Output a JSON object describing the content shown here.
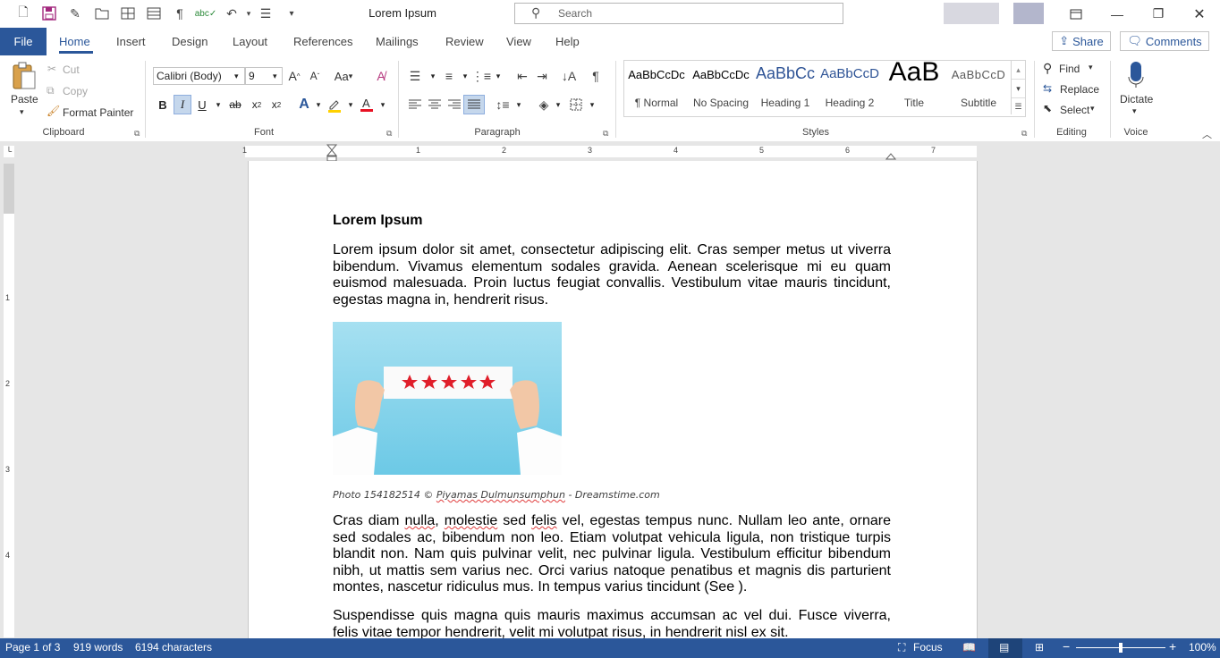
{
  "titlebar": {
    "doc_title": "Lorem Ipsum",
    "search_placeholder": "Search",
    "quick_access_icons": [
      "new-document-icon",
      "save-icon",
      "edit-icon",
      "open-folder-icon",
      "table-icon",
      "layout-icon",
      "pilcrow-icon",
      "spelling-icon",
      "undo-icon",
      "numbering-icon",
      "customize-icon"
    ]
  },
  "menubar": {
    "file": "File",
    "tabs": [
      "Home",
      "Insert",
      "Design",
      "Layout",
      "References",
      "Mailings",
      "Review",
      "View",
      "Help"
    ],
    "share": "Share",
    "comments": "Comments"
  },
  "ribbon": {
    "clipboard": {
      "paste": "Paste",
      "cut": "Cut",
      "copy": "Copy",
      "format_painter": "Format Painter",
      "group": "Clipboard"
    },
    "font": {
      "family": "Calibri (Body)",
      "size": "9",
      "case": "Aa",
      "group": "Font"
    },
    "paragraph": {
      "group": "Paragraph"
    },
    "styles": {
      "group": "Styles",
      "items": [
        {
          "preview": "AaBbCcDc",
          "name": "¶ Normal"
        },
        {
          "preview": "AaBbCcDc",
          "name": "No Spacing"
        },
        {
          "preview": "AaBbCc",
          "name": "Heading 1"
        },
        {
          "preview": "AaBbCcD",
          "name": "Heading 2"
        },
        {
          "preview": "AaB",
          "name": "Title"
        },
        {
          "preview": "AaBbCcD",
          "name": "Subtitle"
        }
      ]
    },
    "editing": {
      "find": "Find",
      "replace": "Replace",
      "select": "Select",
      "group": "Editing"
    },
    "voice": {
      "dictate": "Dictate",
      "group": "Voice"
    }
  },
  "ruler": {
    "h_numbers": [
      "1",
      "1",
      "2",
      "3",
      "4",
      "5",
      "6",
      "7"
    ],
    "v_numbers": [
      "1",
      "2",
      "3",
      "4"
    ]
  },
  "document": {
    "heading": "Lorem Ipsum",
    "para1": "Lorem ipsum dolor sit amet, consectetur adipiscing elit. Cras semper metus ut viverra bibendum. Vivamus elementum sodales gravida. Aenean scelerisque mi eu quam euismod malesuada. Proin luctus feugiat convallis. Vestibulum vitae mauris tincidunt, egestas magna in, hendrerit risus.",
    "caption_pre": "Photo 154182514 © ",
    "caption_name": "Piyamas Dulmunsumphun",
    "caption_post": " - Dreamstime.com",
    "para2_w1": "Cras diam ",
    "para2_sq1": "nulla",
    "para2_w2": ", ",
    "para2_sq2": "molestie",
    "para2_w3": " sed ",
    "para2_sq3": "felis",
    "para2_rest": " vel, egestas tempus nunc. Nullam leo ante, ornare sed sodales ac, bibendum non leo. Etiam volutpat vehicula ligula, non tristique turpis blandit non. Nam quis pulvinar velit, nec pulvinar ligula. Vestibulum efficitur bibendum nibh, ut mattis sem varius nec. Orci varius natoque penatibus et magnis dis parturient montes, nascetur ridiculus mus. In tempus varius tincidunt (See ).",
    "para3": "Suspendisse quis magna quis mauris maximus accumsan ac vel dui. Fusce viverra, felis vitae tempor hendrerit, velit mi volutpat risus, in hendrerit nisl ex sit."
  },
  "statusbar": {
    "page": "Page 1 of 3",
    "words": "919 words",
    "chars": "6194 characters",
    "focus": "Focus",
    "zoom": "100%",
    "zoom_level": 1.0
  },
  "colors": {
    "accent": "#2b579a",
    "font_color": "#e81123",
    "highlight": "#ffd100"
  }
}
